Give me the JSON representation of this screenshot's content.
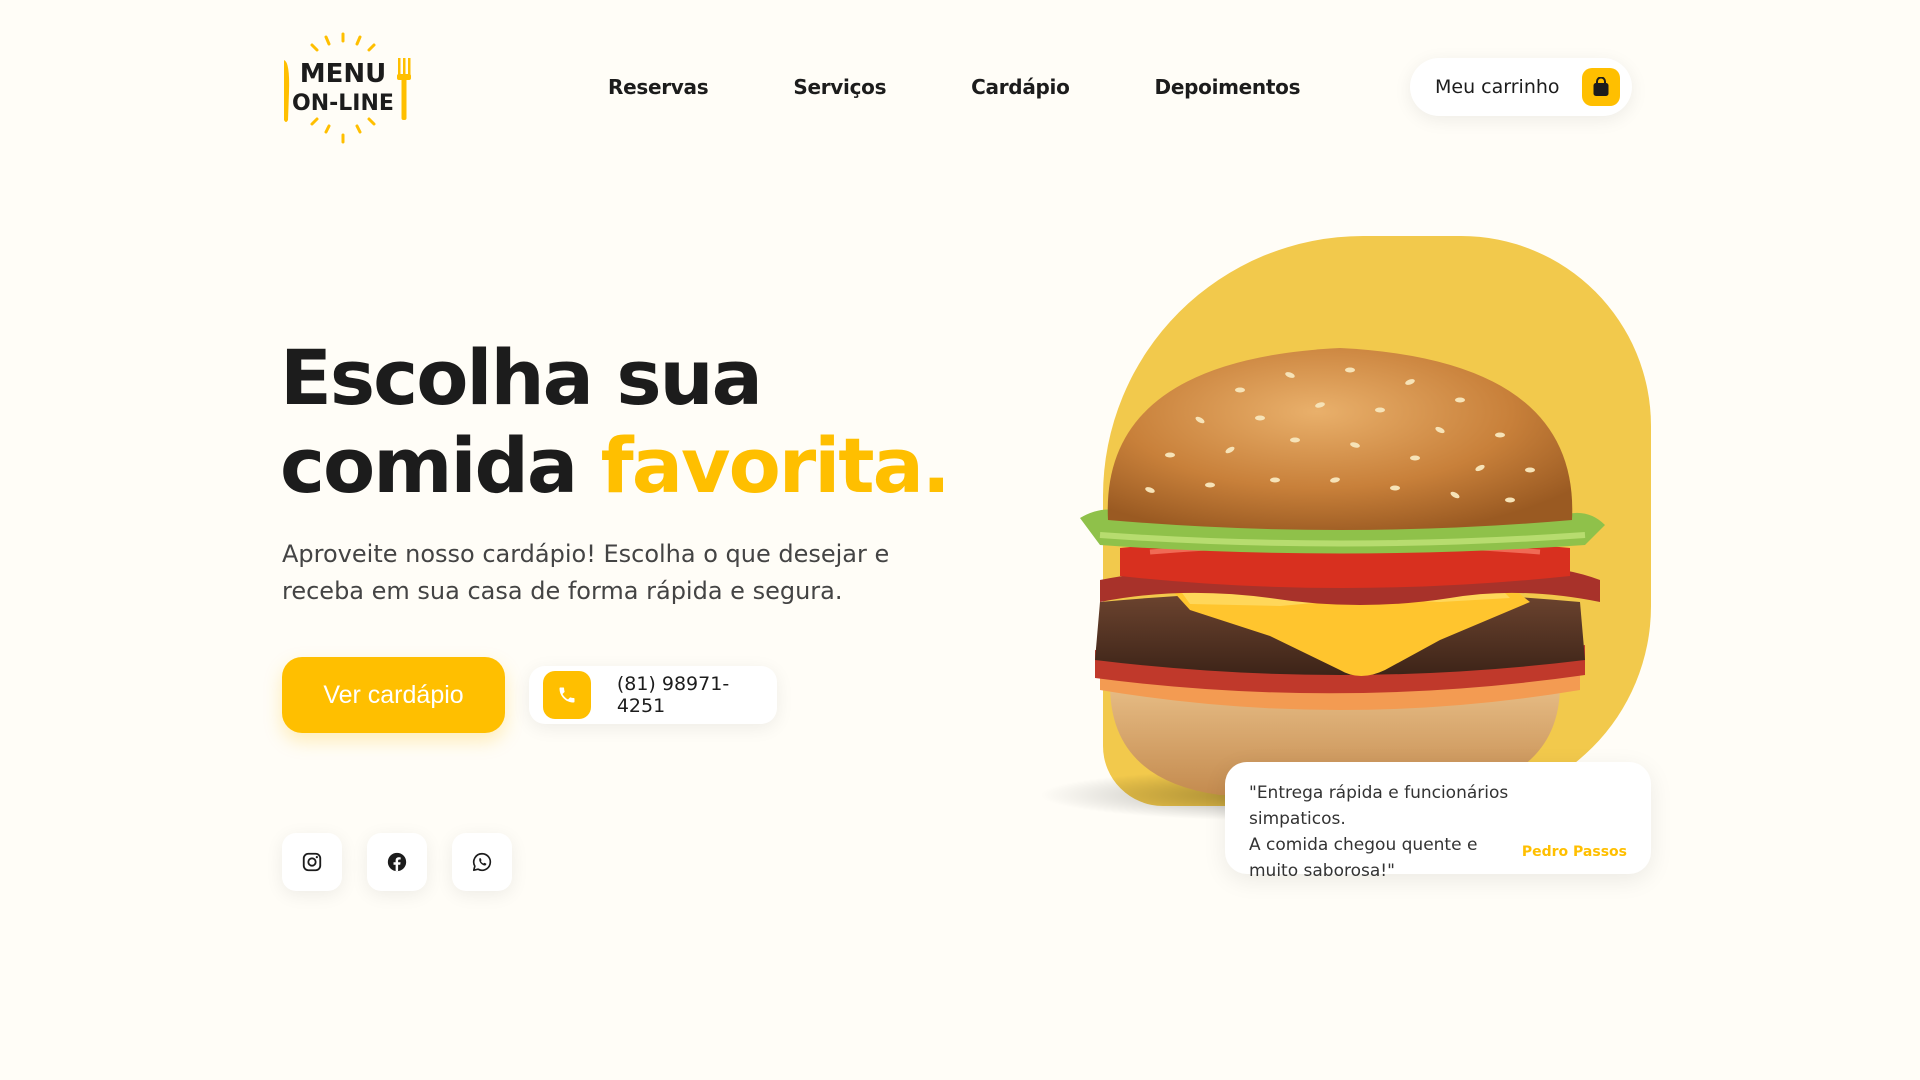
{
  "brand": {
    "logo_line1": "MENU",
    "logo_line2": "ON-LINE"
  },
  "nav": {
    "items": [
      {
        "label": "Reservas"
      },
      {
        "label": "Serviços"
      },
      {
        "label": "Cardápio"
      },
      {
        "label": "Depoimentos"
      }
    ]
  },
  "cart": {
    "label": "Meu carrinho",
    "icon": "shopping-bag-icon"
  },
  "hero": {
    "title_part1": "Escolha sua",
    "title_part2": "comida",
    "title_accent": "favorita.",
    "subtitle_line1": "Aproveite nosso cardápio! Escolha o que desejar e",
    "subtitle_line2": "receba em sua casa de forma rápida e segura.",
    "cta_label": "Ver cardápio",
    "phone": "(81) 98971-4251",
    "phone_icon": "phone-icon"
  },
  "socials": [
    {
      "icon": "instagram-icon"
    },
    {
      "icon": "facebook-icon"
    },
    {
      "icon": "whatsapp-icon"
    }
  ],
  "testimonial": {
    "line1": "\"Entrega rápida e funcionários simpaticos.",
    "line2": "A comida chegou quente e",
    "line3": "muito saborosa!\"",
    "author": "Pedro Passos"
  },
  "colors": {
    "accent": "#ffbf00",
    "blob": "#f2c94c",
    "background": "#fffdf7",
    "text": "#1c1c1c"
  }
}
